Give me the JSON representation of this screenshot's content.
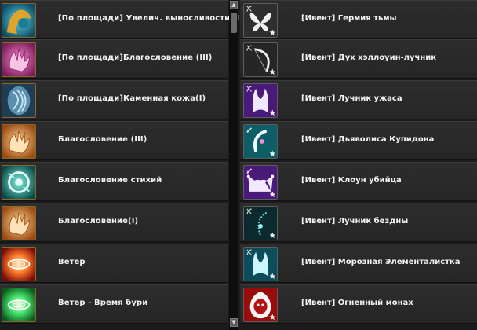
{
  "left_list": [
    {
      "label": "[По площади] Увелич. выносливости (I)",
      "icon": "stamina-buff-icon"
    },
    {
      "label": "[По площади]Благословение (III)",
      "icon": "blessing-hand-pink-icon"
    },
    {
      "label": "[По площади]Каменная кожа(I)",
      "icon": "stone-skin-icon"
    },
    {
      "label": "Благословение (III)",
      "icon": "blessing-hand-icon"
    },
    {
      "label": "Благословение стихий",
      "icon": "elemental-blessing-icon"
    },
    {
      "label": "Благословение(I)",
      "icon": "blessing-hand-icon"
    },
    {
      "label": "Ветер",
      "icon": "wind-red-icon"
    },
    {
      "label": "Ветер - Время бури",
      "icon": "wind-green-icon"
    }
  ],
  "right_list": [
    {
      "label": "[Ивент] Гермия тьмы",
      "icon": "butterfly-wings-icon"
    },
    {
      "label": "[Ивент] Дух хэллоуин-лучник",
      "icon": "bow-icon"
    },
    {
      "label": "[Ивент] Лучник ужаса",
      "icon": "horned-mask-icon"
    },
    {
      "label": "[Ивент] Дьяволиса Купидона",
      "icon": "cupid-bow-icon"
    },
    {
      "label": "[Ивент] Клоун убийца",
      "icon": "jester-hat-icon"
    },
    {
      "label": "[Ивент] Лучник бездны",
      "icon": "abyss-bow-icon"
    },
    {
      "label": "[Ивент] Морозная Элементалистка",
      "icon": "frost-horns-icon"
    },
    {
      "label": "[Ивент] Огненный монах",
      "icon": "hooded-monk-icon"
    }
  ],
  "scrollbar": {
    "up_arrow": "▲",
    "down_arrow": "▼"
  }
}
